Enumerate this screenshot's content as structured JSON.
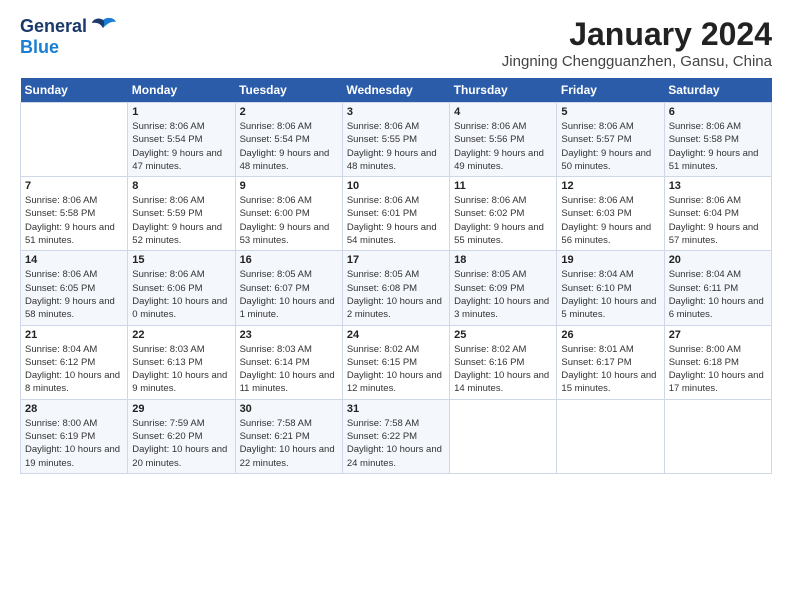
{
  "header": {
    "logo_line1": "General",
    "logo_line2": "Blue",
    "main_title": "January 2024",
    "subtitle": "Jingning Chengguanzhen, Gansu, China"
  },
  "days_of_week": [
    "Sunday",
    "Monday",
    "Tuesday",
    "Wednesday",
    "Thursday",
    "Friday",
    "Saturday"
  ],
  "weeks": [
    [
      {
        "num": "",
        "sunrise": "",
        "sunset": "",
        "daylight": ""
      },
      {
        "num": "1",
        "sunrise": "Sunrise: 8:06 AM",
        "sunset": "Sunset: 5:54 PM",
        "daylight": "Daylight: 9 hours and 47 minutes."
      },
      {
        "num": "2",
        "sunrise": "Sunrise: 8:06 AM",
        "sunset": "Sunset: 5:54 PM",
        "daylight": "Daylight: 9 hours and 48 minutes."
      },
      {
        "num": "3",
        "sunrise": "Sunrise: 8:06 AM",
        "sunset": "Sunset: 5:55 PM",
        "daylight": "Daylight: 9 hours and 48 minutes."
      },
      {
        "num": "4",
        "sunrise": "Sunrise: 8:06 AM",
        "sunset": "Sunset: 5:56 PM",
        "daylight": "Daylight: 9 hours and 49 minutes."
      },
      {
        "num": "5",
        "sunrise": "Sunrise: 8:06 AM",
        "sunset": "Sunset: 5:57 PM",
        "daylight": "Daylight: 9 hours and 50 minutes."
      },
      {
        "num": "6",
        "sunrise": "Sunrise: 8:06 AM",
        "sunset": "Sunset: 5:58 PM",
        "daylight": "Daylight: 9 hours and 51 minutes."
      }
    ],
    [
      {
        "num": "7",
        "sunrise": "Sunrise: 8:06 AM",
        "sunset": "Sunset: 5:58 PM",
        "daylight": "Daylight: 9 hours and 51 minutes."
      },
      {
        "num": "8",
        "sunrise": "Sunrise: 8:06 AM",
        "sunset": "Sunset: 5:59 PM",
        "daylight": "Daylight: 9 hours and 52 minutes."
      },
      {
        "num": "9",
        "sunrise": "Sunrise: 8:06 AM",
        "sunset": "Sunset: 6:00 PM",
        "daylight": "Daylight: 9 hours and 53 minutes."
      },
      {
        "num": "10",
        "sunrise": "Sunrise: 8:06 AM",
        "sunset": "Sunset: 6:01 PM",
        "daylight": "Daylight: 9 hours and 54 minutes."
      },
      {
        "num": "11",
        "sunrise": "Sunrise: 8:06 AM",
        "sunset": "Sunset: 6:02 PM",
        "daylight": "Daylight: 9 hours and 55 minutes."
      },
      {
        "num": "12",
        "sunrise": "Sunrise: 8:06 AM",
        "sunset": "Sunset: 6:03 PM",
        "daylight": "Daylight: 9 hours and 56 minutes."
      },
      {
        "num": "13",
        "sunrise": "Sunrise: 8:06 AM",
        "sunset": "Sunset: 6:04 PM",
        "daylight": "Daylight: 9 hours and 57 minutes."
      }
    ],
    [
      {
        "num": "14",
        "sunrise": "Sunrise: 8:06 AM",
        "sunset": "Sunset: 6:05 PM",
        "daylight": "Daylight: 9 hours and 58 minutes."
      },
      {
        "num": "15",
        "sunrise": "Sunrise: 8:06 AM",
        "sunset": "Sunset: 6:06 PM",
        "daylight": "Daylight: 10 hours and 0 minutes."
      },
      {
        "num": "16",
        "sunrise": "Sunrise: 8:05 AM",
        "sunset": "Sunset: 6:07 PM",
        "daylight": "Daylight: 10 hours and 1 minute."
      },
      {
        "num": "17",
        "sunrise": "Sunrise: 8:05 AM",
        "sunset": "Sunset: 6:08 PM",
        "daylight": "Daylight: 10 hours and 2 minutes."
      },
      {
        "num": "18",
        "sunrise": "Sunrise: 8:05 AM",
        "sunset": "Sunset: 6:09 PM",
        "daylight": "Daylight: 10 hours and 3 minutes."
      },
      {
        "num": "19",
        "sunrise": "Sunrise: 8:04 AM",
        "sunset": "Sunset: 6:10 PM",
        "daylight": "Daylight: 10 hours and 5 minutes."
      },
      {
        "num": "20",
        "sunrise": "Sunrise: 8:04 AM",
        "sunset": "Sunset: 6:11 PM",
        "daylight": "Daylight: 10 hours and 6 minutes."
      }
    ],
    [
      {
        "num": "21",
        "sunrise": "Sunrise: 8:04 AM",
        "sunset": "Sunset: 6:12 PM",
        "daylight": "Daylight: 10 hours and 8 minutes."
      },
      {
        "num": "22",
        "sunrise": "Sunrise: 8:03 AM",
        "sunset": "Sunset: 6:13 PM",
        "daylight": "Daylight: 10 hours and 9 minutes."
      },
      {
        "num": "23",
        "sunrise": "Sunrise: 8:03 AM",
        "sunset": "Sunset: 6:14 PM",
        "daylight": "Daylight: 10 hours and 11 minutes."
      },
      {
        "num": "24",
        "sunrise": "Sunrise: 8:02 AM",
        "sunset": "Sunset: 6:15 PM",
        "daylight": "Daylight: 10 hours and 12 minutes."
      },
      {
        "num": "25",
        "sunrise": "Sunrise: 8:02 AM",
        "sunset": "Sunset: 6:16 PM",
        "daylight": "Daylight: 10 hours and 14 minutes."
      },
      {
        "num": "26",
        "sunrise": "Sunrise: 8:01 AM",
        "sunset": "Sunset: 6:17 PM",
        "daylight": "Daylight: 10 hours and 15 minutes."
      },
      {
        "num": "27",
        "sunrise": "Sunrise: 8:00 AM",
        "sunset": "Sunset: 6:18 PM",
        "daylight": "Daylight: 10 hours and 17 minutes."
      }
    ],
    [
      {
        "num": "28",
        "sunrise": "Sunrise: 8:00 AM",
        "sunset": "Sunset: 6:19 PM",
        "daylight": "Daylight: 10 hours and 19 minutes."
      },
      {
        "num": "29",
        "sunrise": "Sunrise: 7:59 AM",
        "sunset": "Sunset: 6:20 PM",
        "daylight": "Daylight: 10 hours and 20 minutes."
      },
      {
        "num": "30",
        "sunrise": "Sunrise: 7:58 AM",
        "sunset": "Sunset: 6:21 PM",
        "daylight": "Daylight: 10 hours and 22 minutes."
      },
      {
        "num": "31",
        "sunrise": "Sunrise: 7:58 AM",
        "sunset": "Sunset: 6:22 PM",
        "daylight": "Daylight: 10 hours and 24 minutes."
      },
      {
        "num": "",
        "sunrise": "",
        "sunset": "",
        "daylight": ""
      },
      {
        "num": "",
        "sunrise": "",
        "sunset": "",
        "daylight": ""
      },
      {
        "num": "",
        "sunrise": "",
        "sunset": "",
        "daylight": ""
      }
    ]
  ]
}
